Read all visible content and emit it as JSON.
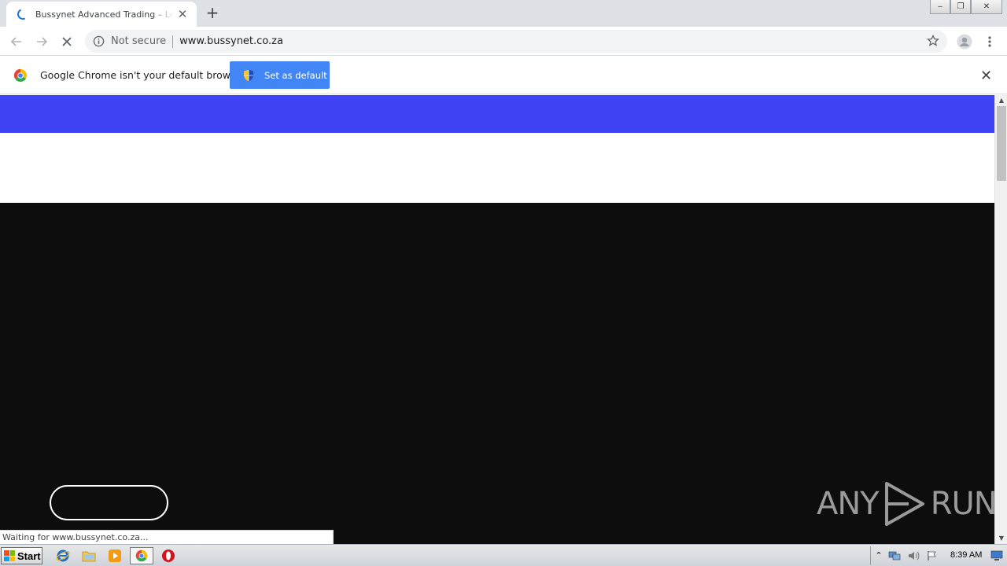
{
  "browser": {
    "tab": {
      "title": "Bussynet Advanced Trading – Leading",
      "close_glyph": "✕"
    },
    "new_tab_glyph": "+",
    "window_controls": {
      "minimize": "‒",
      "restore": "❐",
      "close": "✕"
    },
    "toolbar": {
      "security_text": "Not secure",
      "url": "www.bussynet.co.za"
    },
    "infobar": {
      "message": "Google Chrome isn't your default browser",
      "button_label": "Set as default",
      "close_glyph": "✕"
    },
    "status_text": "Waiting for www.bussynet.co.za...",
    "watermark": {
      "left": "ANY",
      "right": "RUN"
    }
  },
  "page": {
    "colors": {
      "header_band": "#3e43f5",
      "hero_bg": "#0d0d0d",
      "pill_border": "#ffffff"
    }
  },
  "taskbar": {
    "start_label": "Start",
    "clock": "8:39 AM",
    "pinned": [
      "internet-explorer-icon",
      "file-explorer-icon",
      "media-player-icon",
      "chrome-icon",
      "opera-icon"
    ]
  }
}
